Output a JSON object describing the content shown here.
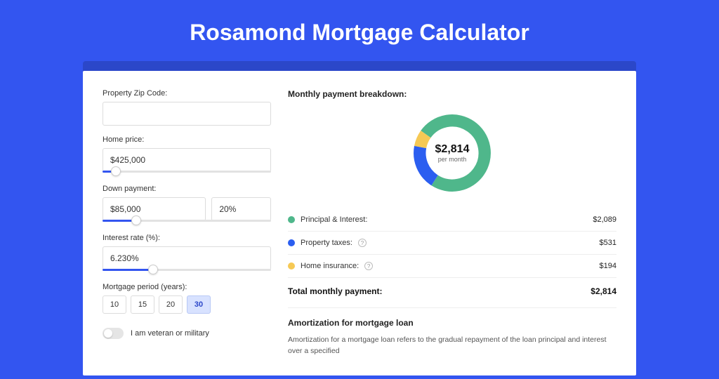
{
  "page": {
    "title": "Rosamond Mortgage Calculator"
  },
  "form": {
    "zip_label": "Property Zip Code:",
    "zip_value": "",
    "price_label": "Home price:",
    "price_value": "$425,000",
    "price_slider_pct": 8,
    "down_label": "Down payment:",
    "down_value": "$85,000",
    "down_pct_value": "20%",
    "down_slider_pct": 20,
    "rate_label": "Interest rate (%):",
    "rate_value": "6.230%",
    "rate_slider_pct": 30,
    "period_label": "Mortgage period (years):",
    "periods": [
      "10",
      "15",
      "20",
      "30"
    ],
    "period_active": "30",
    "veteran_label": "I am veteran or military"
  },
  "breakdown": {
    "title": "Monthly payment breakdown:",
    "total_amount": "$2,814",
    "total_sub": "per month",
    "items": [
      {
        "label": "Principal & Interest:",
        "value": "$2,089",
        "color": "green",
        "info": false
      },
      {
        "label": "Property taxes:",
        "value": "$531",
        "color": "blue",
        "info": true
      },
      {
        "label": "Home insurance:",
        "value": "$194",
        "color": "yellow",
        "info": true
      }
    ],
    "total_label": "Total monthly payment:",
    "total_value": "$2,814"
  },
  "amortization": {
    "title": "Amortization for mortgage loan",
    "text": "Amortization for a mortgage loan refers to the gradual repayment of the loan principal and interest over a specified"
  },
  "chart_data": {
    "type": "pie",
    "title": "Monthly payment breakdown",
    "series": [
      {
        "name": "Principal & Interest",
        "value": 2089,
        "color": "#4fb78b"
      },
      {
        "name": "Property taxes",
        "value": 531,
        "color": "#2b5ef0"
      },
      {
        "name": "Home insurance",
        "value": 194,
        "color": "#f6c955"
      }
    ],
    "total": 2814,
    "unit": "USD/month"
  }
}
